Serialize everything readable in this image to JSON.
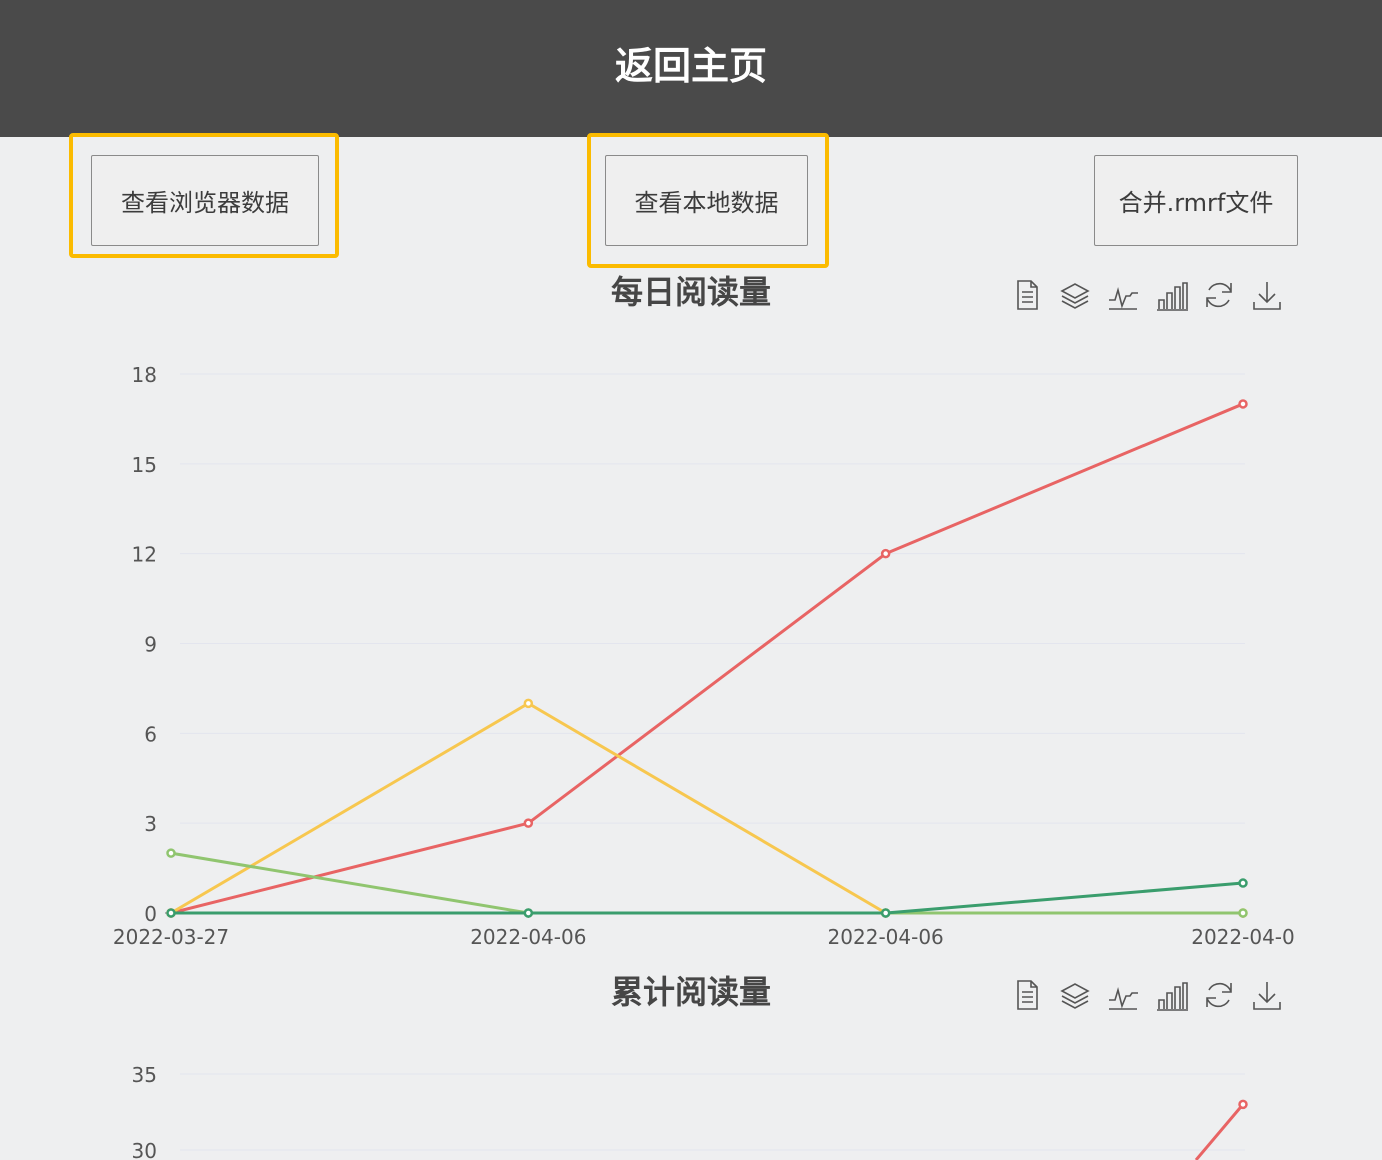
{
  "header": {
    "home_link": "返回主页"
  },
  "buttons": {
    "browser_data": "查看浏览器数据",
    "local_data": "查看本地数据",
    "merge_file": "合并.rmrf文件"
  },
  "colors": {
    "header_bg": "#4a4a4a",
    "highlight": "#fbbb00",
    "series_red": "#e86464",
    "series_yellow": "#f7c74f",
    "series_lightgreen": "#90c56f",
    "series_green": "#3a9d6d"
  },
  "toolbox_icons": [
    "data-view-icon",
    "stack-icon",
    "line-chart-icon",
    "bar-chart-icon",
    "refresh-icon",
    "download-icon"
  ],
  "chart_data": [
    {
      "type": "line",
      "title": "每日阅读量",
      "categories": [
        "2022-03-27",
        "2022-04-06",
        "2022-04-06",
        "2022-04-0"
      ],
      "yticks": [
        "0",
        "3",
        "6",
        "9",
        "12",
        "15",
        "18"
      ],
      "ylim": [
        0,
        18
      ],
      "grid": true,
      "series": [
        {
          "color": "#e86464",
          "values": [
            0,
            3,
            12,
            17
          ]
        },
        {
          "color": "#f7c74f",
          "values": [
            0,
            7,
            0,
            0
          ]
        },
        {
          "color": "#90c56f",
          "values": [
            2,
            0,
            0,
            0
          ]
        },
        {
          "color": "#3a9d6d",
          "values": [
            0,
            0,
            0,
            1
          ]
        }
      ]
    },
    {
      "type": "line",
      "title": "累计阅读量",
      "yticks": [
        "30",
        "35"
      ],
      "ylim": [
        0,
        35
      ],
      "grid": true,
      "series": [
        {
          "color": "#e86464",
          "values": [
            33
          ]
        }
      ]
    }
  ]
}
